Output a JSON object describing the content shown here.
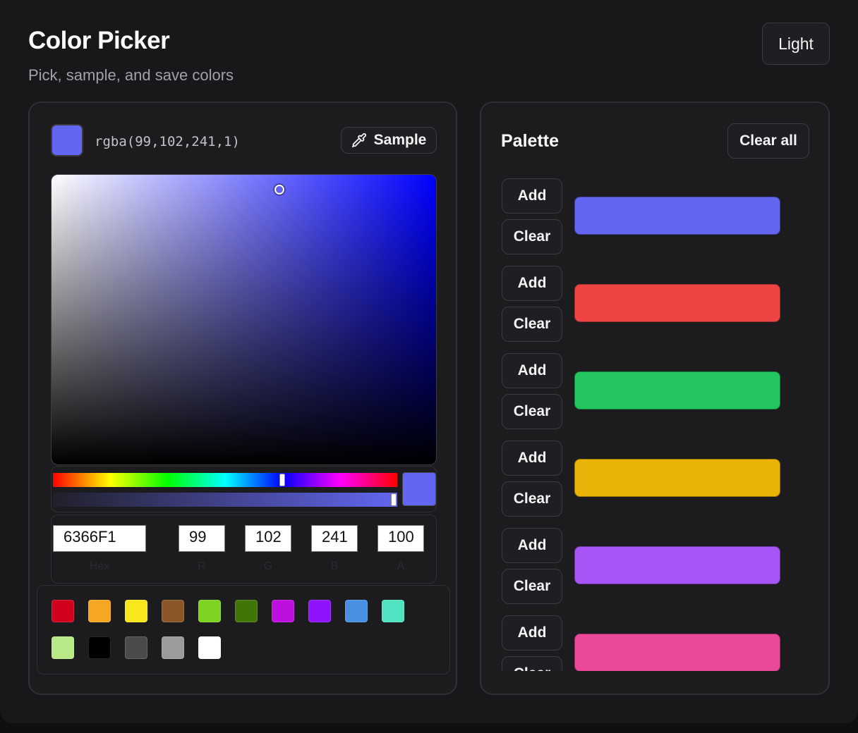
{
  "header": {
    "title": "Color Picker",
    "subtitle": "Pick, sample, and save colors",
    "theme_button": "Light"
  },
  "picker": {
    "current_color": "#6366f1",
    "rgba_text": "rgba(99,102,241,1)",
    "sample_button": "Sample",
    "hue_color": "#0000ff",
    "saturation_value_position": {
      "saturation": 0.59,
      "value": 0.95
    },
    "hue_slider_fraction": 0.665,
    "alpha_slider_fraction": 0.99,
    "fields": {
      "hex": "6366F1",
      "r": "99",
      "g": "102",
      "b": "241",
      "a": "100"
    },
    "field_labels": {
      "hex": "Hex",
      "r": "R",
      "g": "G",
      "b": "B",
      "a": "A"
    },
    "presets": [
      "#d0021b",
      "#f5a623",
      "#f8e71c",
      "#8b572a",
      "#7ed321",
      "#417505",
      "#bd10e0",
      "#9013fe",
      "#4a90e2",
      "#50e3c2",
      "#b8e986",
      "#000000",
      "#4a4a4a",
      "#9b9b9b",
      "#ffffff"
    ]
  },
  "palette": {
    "title": "Palette",
    "clear_all_label": "Clear all",
    "add_label": "Add",
    "clear_label": "Clear",
    "slots": [
      {
        "color": "#6366f1"
      },
      {
        "color": "#ef4444"
      },
      {
        "color": "#22c55e"
      },
      {
        "color": "#eab308"
      },
      {
        "color": "#a855f7"
      },
      {
        "color": "#ec4899"
      }
    ]
  }
}
